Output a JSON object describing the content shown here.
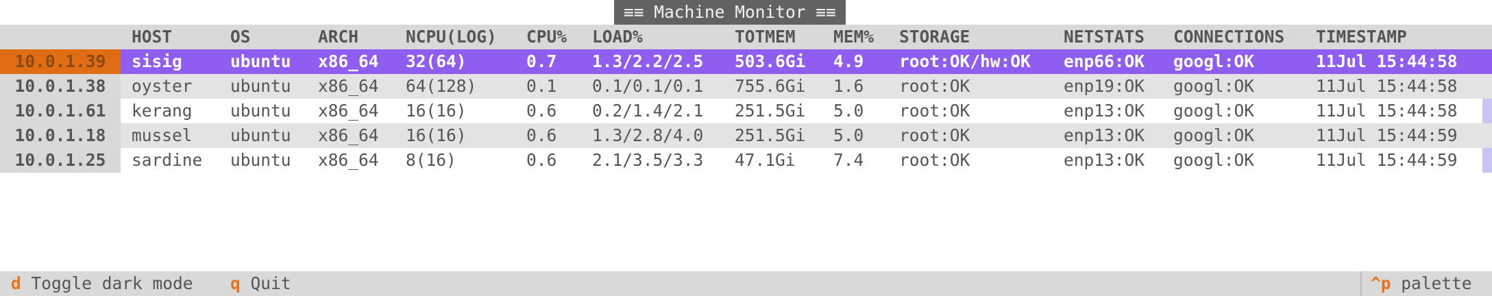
{
  "app": {
    "title": "≡≡ Machine Monitor ≡≡"
  },
  "table": {
    "headers": [
      "HOST",
      "OS",
      "ARCH",
      "NCPU(LOG)",
      "CPU%",
      "LOAD%",
      "TOTMEM",
      "MEM%",
      "STORAGE",
      "NETSTATS",
      "CONNECTIONS",
      "TIMESTAMP"
    ],
    "rows": [
      {
        "ip": "10.0.1.39",
        "cells": [
          "sisig",
          "ubuntu",
          "x86_64",
          "32(64)",
          "0.7",
          "1.3/2.2/2.5",
          "503.6Gi",
          "4.9",
          "root:OK/hw:OK",
          "enp66:OK",
          "googl:OK",
          "11Jul 15:44:58"
        ]
      },
      {
        "ip": "10.0.1.38",
        "cells": [
          "oyster",
          "ubuntu",
          "x86_64",
          "64(128)",
          "0.1",
          "0.1/0.1/0.1",
          "755.6Gi",
          "1.6",
          "root:OK",
          "enp19:OK",
          "googl:OK",
          "11Jul 15:44:58"
        ]
      },
      {
        "ip": "10.0.1.61",
        "cells": [
          "kerang",
          "ubuntu",
          "x86_64",
          "16(16)",
          "0.6",
          "0.2/1.4/2.1",
          "251.5Gi",
          "5.0",
          "root:OK",
          "enp13:OK",
          "googl:OK",
          "11Jul 15:44:58"
        ]
      },
      {
        "ip": "10.0.1.18",
        "cells": [
          "mussel",
          "ubuntu",
          "x86_64",
          "16(16)",
          "0.6",
          "1.3/2.8/4.0",
          "251.5Gi",
          "5.0",
          "root:OK",
          "enp13:OK",
          "googl:OK",
          "11Jul 15:44:59"
        ]
      },
      {
        "ip": "10.0.1.25",
        "cells": [
          "sardine",
          "ubuntu",
          "x86_64",
          "8(16)",
          "0.6",
          "2.1/3.5/3.3",
          "47.1Gi",
          "7.4",
          "root:OK",
          "enp13:OK",
          "googl:OK",
          "11Jul 15:44:59"
        ]
      }
    ],
    "selected_row": 0
  },
  "footer": {
    "bindings": [
      {
        "key": "d",
        "label": "Toggle dark mode"
      },
      {
        "key": "q",
        "label": "Quit"
      }
    ],
    "palette": {
      "key": "^p",
      "label": "palette"
    }
  },
  "colors": {
    "selected_row": "#8f5df0",
    "selected_ip": "#e06d14",
    "key_accent": "#e8731a",
    "title_bg": "#626262"
  }
}
